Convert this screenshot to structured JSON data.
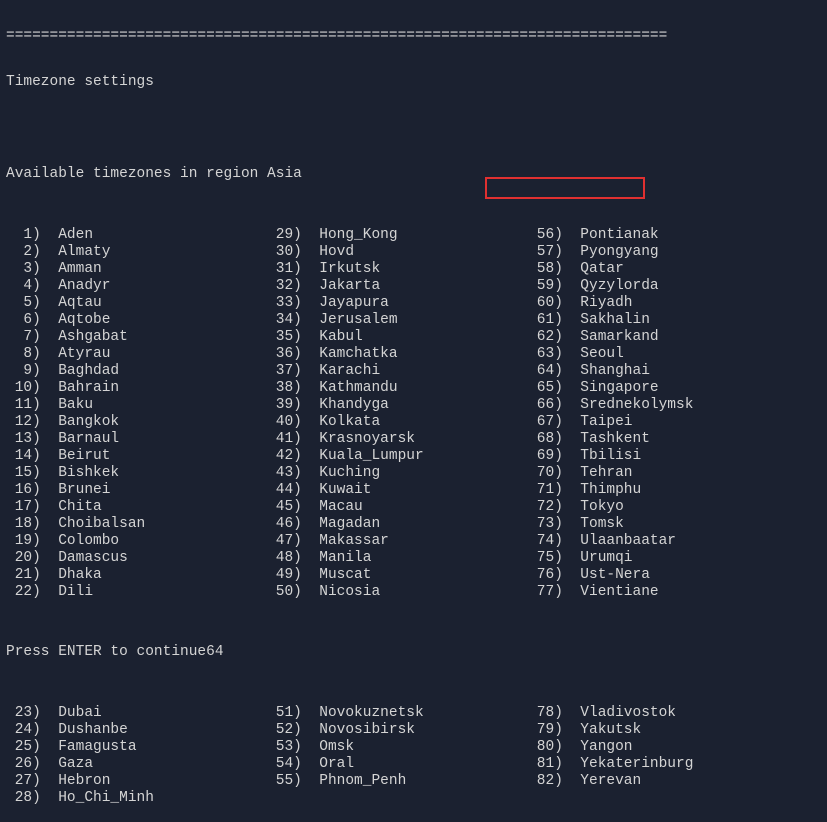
{
  "separator": "============================================================================",
  "title": "Timezone settings",
  "subtitle": "Available timezones in region Asia",
  "prompt_mid": "Press ENTER to continue64",
  "bottom_cut": "",
  "highlighted_index": 64,
  "col1": [
    {
      "i": "1",
      "n": "Aden"
    },
    {
      "i": "2",
      "n": "Almaty"
    },
    {
      "i": "3",
      "n": "Amman"
    },
    {
      "i": "4",
      "n": "Anadyr"
    },
    {
      "i": "5",
      "n": "Aqtau"
    },
    {
      "i": "6",
      "n": "Aqtobe"
    },
    {
      "i": "7",
      "n": "Ashgabat"
    },
    {
      "i": "8",
      "n": "Atyrau"
    },
    {
      "i": "9",
      "n": "Baghdad"
    },
    {
      "i": "10",
      "n": "Bahrain"
    },
    {
      "i": "11",
      "n": "Baku"
    },
    {
      "i": "12",
      "n": "Bangkok"
    },
    {
      "i": "13",
      "n": "Barnaul"
    },
    {
      "i": "14",
      "n": "Beirut"
    },
    {
      "i": "15",
      "n": "Bishkek"
    },
    {
      "i": "16",
      "n": "Brunei"
    },
    {
      "i": "17",
      "n": "Chita"
    },
    {
      "i": "18",
      "n": "Choibalsan"
    },
    {
      "i": "19",
      "n": "Colombo"
    },
    {
      "i": "20",
      "n": "Damascus"
    },
    {
      "i": "21",
      "n": "Dhaka"
    },
    {
      "i": "22",
      "n": "Dili"
    }
  ],
  "col2": [
    {
      "i": "29",
      "n": "Hong_Kong"
    },
    {
      "i": "30",
      "n": "Hovd"
    },
    {
      "i": "31",
      "n": "Irkutsk"
    },
    {
      "i": "32",
      "n": "Jakarta"
    },
    {
      "i": "33",
      "n": "Jayapura"
    },
    {
      "i": "34",
      "n": "Jerusalem"
    },
    {
      "i": "35",
      "n": "Kabul"
    },
    {
      "i": "36",
      "n": "Kamchatka"
    },
    {
      "i": "37",
      "n": "Karachi"
    },
    {
      "i": "38",
      "n": "Kathmandu"
    },
    {
      "i": "39",
      "n": "Khandyga"
    },
    {
      "i": "40",
      "n": "Kolkata"
    },
    {
      "i": "41",
      "n": "Krasnoyarsk"
    },
    {
      "i": "42",
      "n": "Kuala_Lumpur"
    },
    {
      "i": "43",
      "n": "Kuching"
    },
    {
      "i": "44",
      "n": "Kuwait"
    },
    {
      "i": "45",
      "n": "Macau"
    },
    {
      "i": "46",
      "n": "Magadan"
    },
    {
      "i": "47",
      "n": "Makassar"
    },
    {
      "i": "48",
      "n": "Manila"
    },
    {
      "i": "49",
      "n": "Muscat"
    },
    {
      "i": "50",
      "n": "Nicosia"
    }
  ],
  "col3": [
    {
      "i": "56",
      "n": "Pontianak"
    },
    {
      "i": "57",
      "n": "Pyongyang"
    },
    {
      "i": "58",
      "n": "Qatar"
    },
    {
      "i": "59",
      "n": "Qyzylorda"
    },
    {
      "i": "60",
      "n": "Riyadh"
    },
    {
      "i": "61",
      "n": "Sakhalin"
    },
    {
      "i": "62",
      "n": "Samarkand"
    },
    {
      "i": "63",
      "n": "Seoul"
    },
    {
      "i": "64",
      "n": "Shanghai"
    },
    {
      "i": "65",
      "n": "Singapore"
    },
    {
      "i": "66",
      "n": "Srednekolymsk"
    },
    {
      "i": "67",
      "n": "Taipei"
    },
    {
      "i": "68",
      "n": "Tashkent"
    },
    {
      "i": "69",
      "n": "Tbilisi"
    },
    {
      "i": "70",
      "n": "Tehran"
    },
    {
      "i": "71",
      "n": "Thimphu"
    },
    {
      "i": "72",
      "n": "Tokyo"
    },
    {
      "i": "73",
      "n": "Tomsk"
    },
    {
      "i": "74",
      "n": "Ulaanbaatar"
    },
    {
      "i": "75",
      "n": "Urumqi"
    },
    {
      "i": "76",
      "n": "Ust-Nera"
    },
    {
      "i": "77",
      "n": "Vientiane"
    }
  ],
  "col1b": [
    {
      "i": "23",
      "n": "Dubai"
    },
    {
      "i": "24",
      "n": "Dushanbe"
    },
    {
      "i": "25",
      "n": "Famagusta"
    },
    {
      "i": "26",
      "n": "Gaza"
    },
    {
      "i": "27",
      "n": "Hebron"
    },
    {
      "i": "28",
      "n": "Ho_Chi_Minh"
    }
  ],
  "col2b": [
    {
      "i": "51",
      "n": "Novokuznetsk"
    },
    {
      "i": "52",
      "n": "Novosibirsk"
    },
    {
      "i": "53",
      "n": "Omsk"
    },
    {
      "i": "54",
      "n": "Oral"
    },
    {
      "i": "55",
      "n": "Phnom_Penh"
    },
    {
      "i": "",
      "n": ""
    }
  ],
  "col3b": [
    {
      "i": "78",
      "n": "Vladivostok"
    },
    {
      "i": "79",
      "n": "Yakutsk"
    },
    {
      "i": "80",
      "n": "Yangon"
    },
    {
      "i": "81",
      "n": "Yekaterinburg"
    },
    {
      "i": "82",
      "n": "Yerevan"
    },
    {
      "i": "",
      "n": ""
    }
  ]
}
